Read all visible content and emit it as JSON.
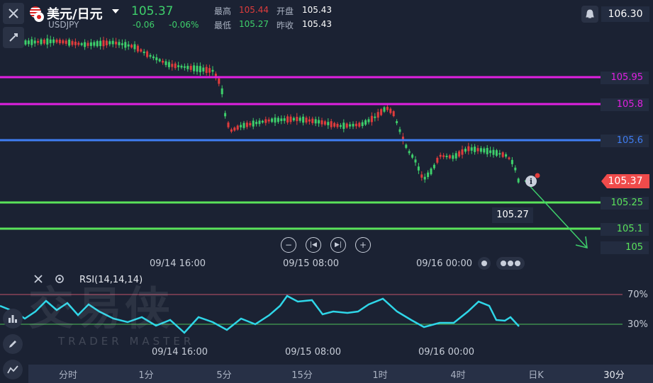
{
  "header": {
    "title": "美元/日元",
    "symbol": "USDJPY",
    "price": "105.37",
    "change": "-0.06",
    "change_pct": "-0.06%",
    "high_label": "最高",
    "high": "105.44",
    "low_label": "最低",
    "low": "105.27",
    "open_label": "开盘",
    "open": "105.43",
    "prev_close_label": "昨收",
    "prev_close": "105.43",
    "top_right_price": "106.30"
  },
  "levels": [
    {
      "value": "105.95",
      "color": "#e020e0"
    },
    {
      "value": "105.8",
      "color": "#e020e0"
    },
    {
      "value": "105.6",
      "color": "#3f7df2"
    },
    {
      "value": "105.25",
      "color": "#5ae35a"
    },
    {
      "value": "105.1",
      "color": "#5ae35a"
    },
    {
      "value": "105",
      "color": "#5ae35a"
    }
  ],
  "current_price_tag": "105.37",
  "low_tooltip": "105.27",
  "time_axis": [
    "09/14 16:00",
    "09/15 08:00",
    "09/16 00:00"
  ],
  "rsi": {
    "label": "RSI(14,14,14)",
    "upper": "70%",
    "lower": "30%",
    "time_axis": [
      "09/14 16:00",
      "09/15 08:00",
      "09/16 00:00"
    ]
  },
  "watermark": {
    "cn": "交易侠",
    "en": "TRADER MASTER"
  },
  "timeframes": [
    "分时",
    "1分",
    "5分",
    "15分",
    "1时",
    "4时",
    "日K",
    "30分"
  ],
  "colors": {
    "up": "#e03c3c",
    "down": "#3ecf6b",
    "rsi": "#2fd6e8",
    "bg": "#1b2233"
  }
}
